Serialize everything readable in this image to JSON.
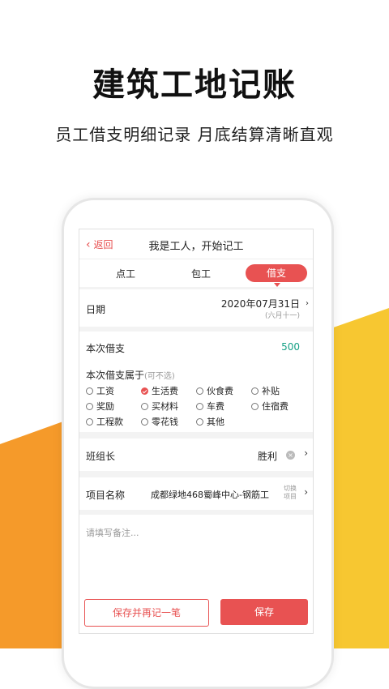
{
  "hero": {
    "headline": "建筑工地记账",
    "subline": "员工借支明细记录  月底结算清晰直观"
  },
  "colors": {
    "accent": "#e85252",
    "orange": "#f59a2a",
    "yellow": "#f7c731",
    "amount": "#16a085"
  },
  "topbar": {
    "back_label": "返回",
    "title": "我是工人，开始记工"
  },
  "tabs": [
    {
      "label": "点工",
      "active": false
    },
    {
      "label": "包工",
      "active": false
    },
    {
      "label": "借支",
      "active": true
    }
  ],
  "date": {
    "label": "日期",
    "value": "2020年07月31日",
    "lunar": "(六月十一)",
    "trailing": "›"
  },
  "amount": {
    "label": "本次借支",
    "value": "500"
  },
  "category": {
    "label": "本次借支属于",
    "hint": "(可不选)",
    "options": [
      {
        "label": "工资",
        "checked": false
      },
      {
        "label": "生活费",
        "checked": true
      },
      {
        "label": "伙食费",
        "checked": false
      },
      {
        "label": "补贴",
        "checked": false
      },
      {
        "label": "奖励",
        "checked": false
      },
      {
        "label": "买材料",
        "checked": false
      },
      {
        "label": "车费",
        "checked": false
      },
      {
        "label": "住宿费",
        "checked": false
      },
      {
        "label": "工程款",
        "checked": false
      },
      {
        "label": "零花钱",
        "checked": false
      },
      {
        "label": "其他",
        "checked": false
      }
    ]
  },
  "leader": {
    "label": "班组长",
    "value": "胜利"
  },
  "project": {
    "label": "项目名称",
    "value": "成都绿地468蜀峰中心-钢筋工",
    "switch_line1": "切换",
    "switch_line2": "项目"
  },
  "note": {
    "placeholder": "请填写备注..."
  },
  "actions": {
    "save_and_continue": "保存并再记一笔",
    "save": "保存"
  }
}
